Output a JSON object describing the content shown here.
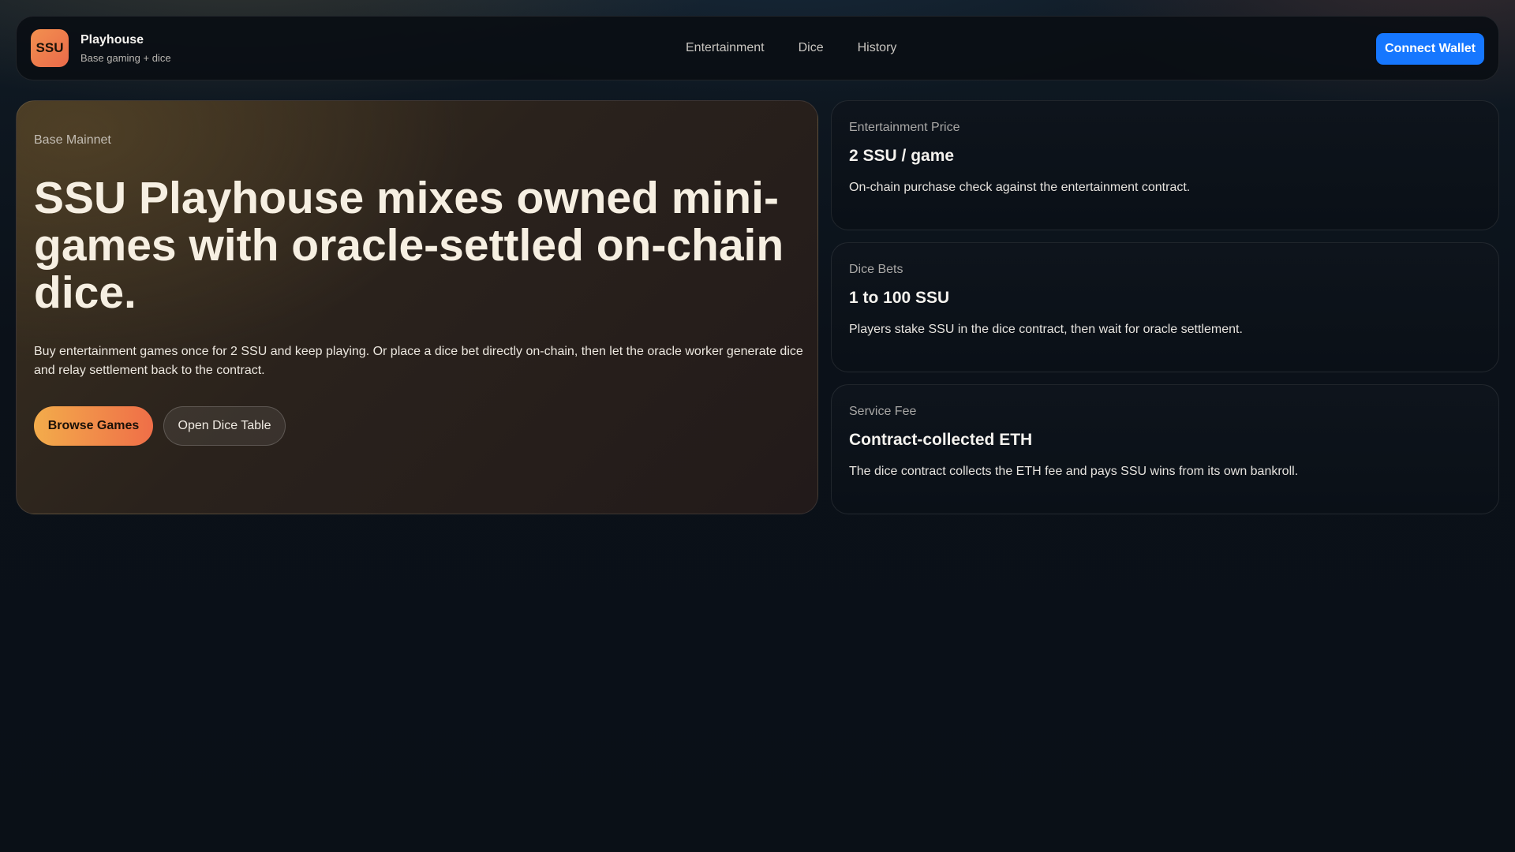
{
  "header": {
    "logo_text": "SSU",
    "brand_title": "Playhouse",
    "brand_subtitle": "Base gaming + dice",
    "nav": [
      "Entertainment",
      "Dice",
      "History"
    ],
    "connect_label": "Connect Wallet"
  },
  "hero": {
    "kicker": "Base Mainnet",
    "title": "SSU Playhouse mixes owned mini-games with oracle-settled on-chain dice.",
    "description": "Buy entertainment games once for 2 SSU and keep playing. Or place a dice bet directly on-chain, then let the oracle worker generate dice and relay settlement back to the contract.",
    "primary_label": "Browse Games",
    "secondary_label": "Open Dice Table"
  },
  "cards": [
    {
      "label": "Entertainment Price",
      "value": "2 SSU / game",
      "desc": "On-chain purchase check against the entertainment contract."
    },
    {
      "label": "Dice Bets",
      "value": "1 to 100 SSU",
      "desc": "Players stake SSU in the dice contract, then wait for oracle settlement."
    },
    {
      "label": "Service Fee",
      "value": "Contract-collected ETH",
      "desc": "The dice contract collects the ETH fee and pays SSU wins from its own bankroll."
    }
  ],
  "colors": {
    "accent_blue": "#1677ff",
    "accent_orange": "#ef6e48",
    "accent_amber": "#f3ac4b"
  }
}
